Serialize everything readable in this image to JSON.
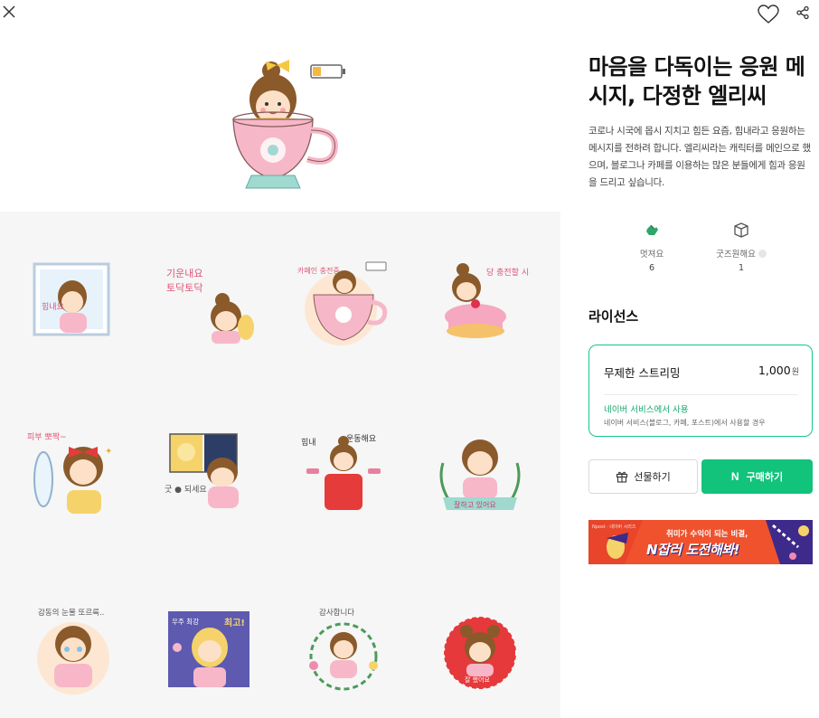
{
  "topbar": {
    "close": "close",
    "like": "like",
    "share": "share"
  },
  "product": {
    "title": "마음을 다독이는 응원 메시지, 다정한 엘리씨",
    "description": "코로나 시국에 몹시 지치고 힘든 요즘, 힘내라고 응원하는 메시지를 전하려 합니다. 엘리씨라는 캐릭터를 메인으로 했으며, 블로그나 카페를 이용하는 많은 분들에게 힘과 응원을 드리고 싶습니다."
  },
  "stats": {
    "like_label": "멋져요",
    "like_count": "6",
    "goods_label": "굿즈원해요",
    "goods_count": "1"
  },
  "license": {
    "heading": "라이선스",
    "name": "무제한 스트리밍",
    "price": "1,000",
    "currency": "원",
    "usage": "네이버 서비스에서 사용",
    "note": "네이버 서비스(블로그, 카페, 포스트)에서 사용할 경우"
  },
  "buttons": {
    "gift": "선물하기",
    "buy": "구매하기"
  },
  "banner": {
    "small": "Npost · 네이버 시리즈",
    "top": "취미가 수익이 되는 비결,",
    "main": "N잡러 도전해봐!"
  },
  "stickers": {
    "s1": "힘내요",
    "s2a": "기운내요",
    "s2b": "토닥토닥",
    "s3": "카페인 충전중",
    "s4": "당 충전할 시간",
    "s5": "피부 뽀짝~",
    "s6": "굿 ● 되세요",
    "s7a": "힘내",
    "s7b": "운동해요",
    "s8": "잘하고 있어요",
    "s9": "감동의 눈물 또르륵..",
    "s10a": "우주 최강",
    "s10b": "최고!",
    "s11": "감사합니다",
    "s12": "잘 했어요"
  },
  "colors": {
    "accent": "#12c37b",
    "grid_bg": "#f5f6f5",
    "banner_bg": "#f0522e"
  },
  "icons": {
    "close": "close-icon",
    "like": "heart-icon",
    "share": "share-icon",
    "like_stat": "clap-icon",
    "goods_stat": "box-icon",
    "gift": "gift-icon",
    "buy": "naver-n-icon"
  }
}
